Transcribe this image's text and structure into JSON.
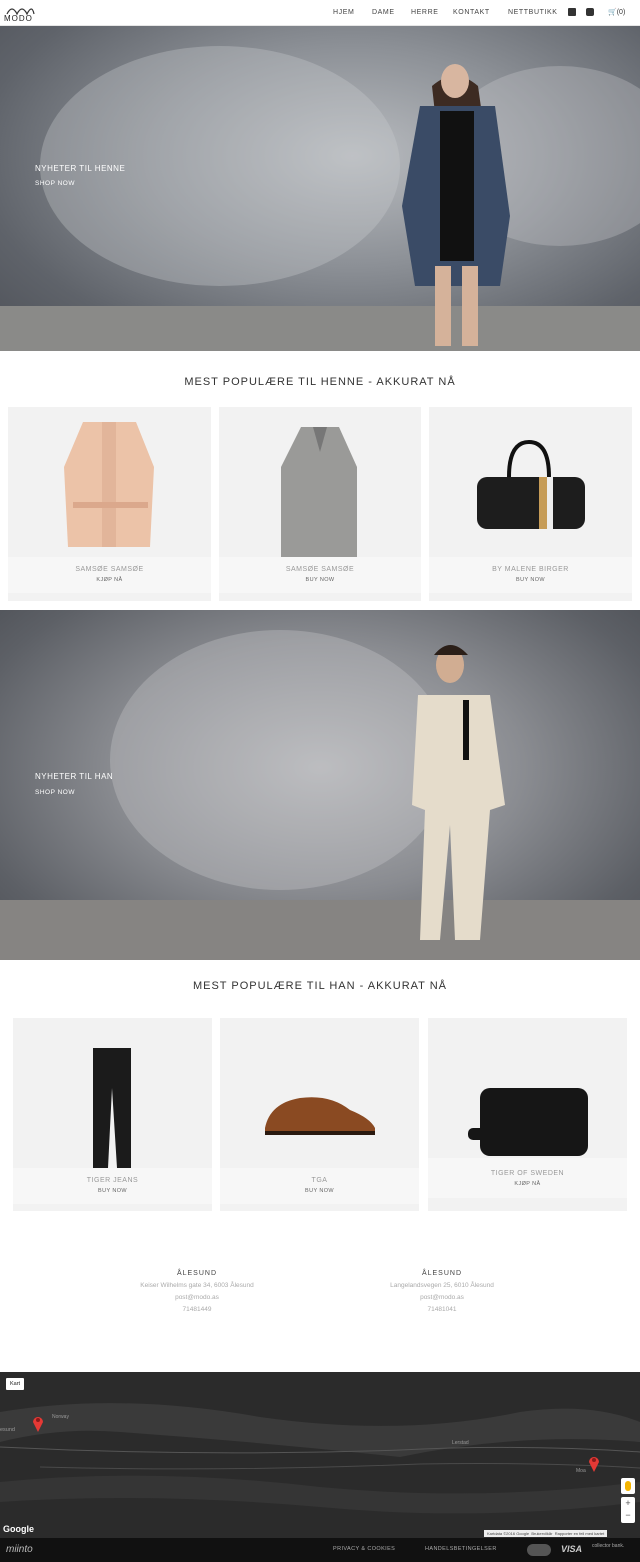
{
  "header": {
    "logo_text": "MODO",
    "nav": [
      "HJEM",
      "DAME",
      "HERRE",
      "KONTAKT",
      "NETTBUTIKK"
    ],
    "cart_label": "(0)"
  },
  "hero_women": {
    "title": "NYHETER TIL HENNE",
    "cta": "SHOP NOW"
  },
  "popular_women": {
    "title": "MEST POPULÆRE TIL HENNE - AKKURAT NÅ",
    "products": [
      {
        "brand": "SAMSØE SAMSØE",
        "cta": "KJØP NÅ"
      },
      {
        "brand": "SAMSØE SAMSØE",
        "cta": "BUY NOW"
      },
      {
        "brand": "BY MALENE BIRGER",
        "cta": "BUY NOW"
      }
    ]
  },
  "hero_men": {
    "title": "NYHETER TIL HAN",
    "cta": "SHOP NOW"
  },
  "popular_men": {
    "title": "MEST POPULÆRE TIL HAN - AKKURAT NÅ",
    "products": [
      {
        "brand": "TIGER JEANS",
        "cta": "BUY NOW"
      },
      {
        "brand": "TGA",
        "cta": "BUY NOW"
      },
      {
        "brand": "TIGER OF SWEDEN",
        "cta": "KJØP NÅ"
      }
    ]
  },
  "stores": [
    {
      "city": "ÅLESUND",
      "address": "Keiser Wilhelms gate 34, 6003 Ålesund",
      "email": "post@modo.as",
      "phone": "71481449"
    },
    {
      "city": "ÅLESUND",
      "address": "Langelandsvegen 25, 6010 Ålesund",
      "email": "post@modo.as",
      "phone": "71481041"
    }
  ],
  "map": {
    "button": "Kart",
    "label_norway": "Norway",
    "label_left": "esund",
    "label_lerstad": "Lerstad",
    "label_moa": "Moa",
    "google": "Google",
    "attribution": [
      "Kartdata ©2016 Google",
      "Brukervilkår",
      "Rapporter en feil med kartet"
    ],
    "zoom_in": "+",
    "zoom_out": "−"
  },
  "footer": {
    "brand": "miinto",
    "links": [
      "PRIVACY & COOKIES",
      "HANDELSBETINGELSER"
    ],
    "payment_visa": "VISA",
    "payment_collector": "collector bank."
  }
}
